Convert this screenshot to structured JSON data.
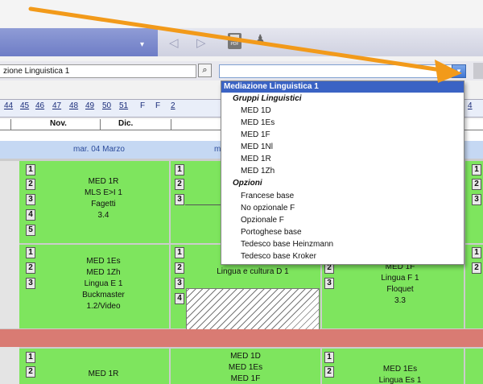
{
  "toolbar": {
    "pdf_label": "PDF",
    "dropdown_glyph": "▾",
    "back_glyph": "◁",
    "forward_glyph": "▷",
    "user_glyph": "♟"
  },
  "selector": {
    "course_value": "zione Linguistica 1",
    "search_glyph": "⌕",
    "dropdown_glyph": "▾"
  },
  "weeks": [
    "44",
    "45",
    "46",
    "47",
    "48",
    "49",
    "50",
    "51"
  ],
  "holiday_marks": [
    "F",
    "F",
    "2"
  ],
  "right_week": "4",
  "months": [
    "Nov.",
    "Dic."
  ],
  "days": [
    "mar. 04 Marzo",
    "m"
  ],
  "rows": {
    "r1": {
      "slots": [
        "1",
        "2",
        "3",
        "4",
        "5"
      ],
      "text": [
        "MED 1R",
        "MLS E>I 1",
        "Fagetti",
        "3.4"
      ],
      "mid_slots": [
        "1",
        "2",
        "3"
      ],
      "right_slots": [
        "1",
        "2",
        "3"
      ]
    },
    "r2": {
      "slots": [
        "1",
        "2",
        "3"
      ],
      "text": [
        "MED 1Es",
        "MED 1Zh",
        "Lingua E 1",
        "Buckmaster",
        "1.2/Video"
      ],
      "mid_slots": [
        "1",
        "2",
        "3",
        "4"
      ],
      "mid_text": "Lingua e cultura D 1",
      "right_slots": [
        "1",
        "2",
        "3"
      ],
      "right_text": [
        "MED 1F",
        "Lingua F 1",
        "Floquet",
        "3.3"
      ],
      "far_slots": [
        "1",
        "2"
      ]
    },
    "r3": {
      "slots": [
        "1",
        "2"
      ],
      "text": [
        "MED 1R"
      ],
      "mid_text": [
        "MED 1D",
        "MED 1Es",
        "MED 1F"
      ],
      "right_slots": [
        "1",
        "2"
      ],
      "right_text": [
        "MED 1Es",
        "Lingua Es 1"
      ]
    }
  },
  "dropdown": {
    "title": "Mediazione Linguistica 1",
    "groups": [
      {
        "label": "Gruppi Linguistici",
        "items": [
          "MED 1D",
          "MED 1Es",
          "MED 1F",
          "MED 1Nl",
          "MED 1R",
          "MED 1Zh"
        ]
      },
      {
        "label": "Opzioni",
        "items": [
          "Francese base",
          "No opzionale F",
          "Opzionale F",
          "Portoghese base",
          "Tedesco base Heinzmann",
          "Tedesco base Kroker"
        ]
      }
    ]
  },
  "colors": {
    "accent": "#3a63c4",
    "green": "#7ee55e",
    "arrow": "#f29a1a",
    "band": "#d97b73"
  }
}
